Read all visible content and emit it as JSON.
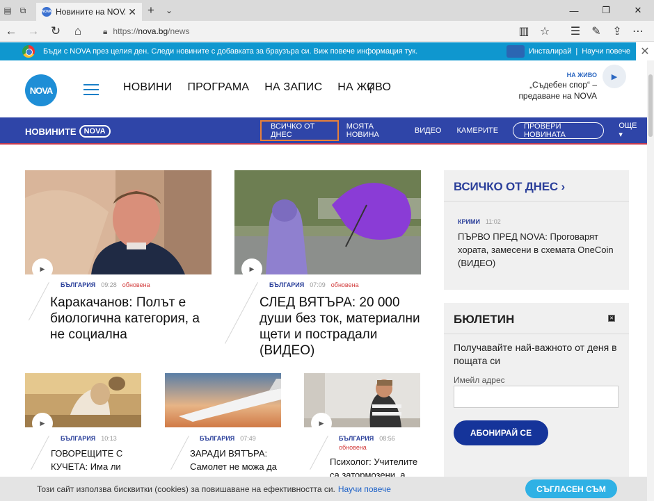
{
  "browser": {
    "tab_title": "Новините на NOVA - N",
    "tab_favicon_text": "NOVA",
    "url_prefix": "https://",
    "url_host": "nova.bg",
    "url_path": "/news"
  },
  "notification": {
    "text": "Бъди с NOVA през целия ден. Следи новините с добавката за браузъра си. Виж повече информация тук.",
    "install_label": "Инсталирай",
    "learn_label": "Научи повече",
    "separator": "|"
  },
  "header": {
    "logo_text": "NOVA",
    "nav": [
      "НОВИНИ",
      "ПРОГРАМА",
      "НА ЗАПИС",
      "НА ЖИВО"
    ],
    "live_label": "НА ЖИВО",
    "live_line1": "„Съдебен спор“ –",
    "live_line2": "предаване на NOVA"
  },
  "section_nav": {
    "brand_prefix": "НОВИНИТЕ",
    "brand_logo": "NOVA",
    "items": [
      "ВСИЧКО ОТ ДНЕС",
      "МОЯТА НОВИНА",
      "ВИДЕО",
      "КАМЕРИТЕ",
      "ПРОВЕРИ НОВИНАТА",
      "ОЩЕ ▾"
    ]
  },
  "articles": [
    {
      "category": "БЪЛГАРИЯ",
      "time": "09:28",
      "updated": "обновена",
      "title": "Каракачанов: Полът е биологична категория, а не социална"
    },
    {
      "category": "БЪЛГАРИЯ",
      "time": "07:09",
      "updated": "обновена",
      "title": "СЛЕД ВЯТЪРА: 20 000 души без ток, материални щети и пострадали (ВИДЕО)"
    },
    {
      "category": "БЪЛГАРИЯ",
      "time": "10:13",
      "updated": "",
      "title": "ГОВОРЕЩИТЕ С КУЧЕТА: Има ли"
    },
    {
      "category": "БЪЛГАРИЯ",
      "time": "07:49",
      "updated": "",
      "title": "ЗАРАДИ ВЯТЪРА: Самолет не можа да"
    },
    {
      "category": "БЪЛГАРИЯ",
      "time": "08:56",
      "updated": "обновена",
      "title": "Психолог: Учителите са затормозени, а"
    }
  ],
  "sidebar": {
    "today_title": "ВСИЧКО ОТ ДНЕС ›",
    "today_item": {
      "category": "КРИМИ",
      "time": "11:02",
      "title": "ПЪРВО ПРЕД NOVA: Проговарят хората, замесени в схемата OneCoin (ВИДЕО)"
    },
    "newsletter_title": "БЮЛЕТИН",
    "newsletter_desc": "Получавайте най-важното от деня в пощата си",
    "email_label": "Имейл адрес",
    "email_value": "",
    "subscribe_label": "АБОНИРАЙ СЕ"
  },
  "cookie": {
    "text": "Този сайт използва бисквитки (cookies) за повишаване на ефективността си.",
    "link": "Научи повече",
    "button": "СЪГЛАСЕН СЪМ"
  },
  "colors": {
    "section_nav_bg": "#2f45a8",
    "active_outline": "#e8803a",
    "notification_bg": "#0f97cf",
    "category_blue": "#2a3f9a",
    "updated_red": "#d23b3b",
    "cookie_button": "#2fb1e5"
  }
}
